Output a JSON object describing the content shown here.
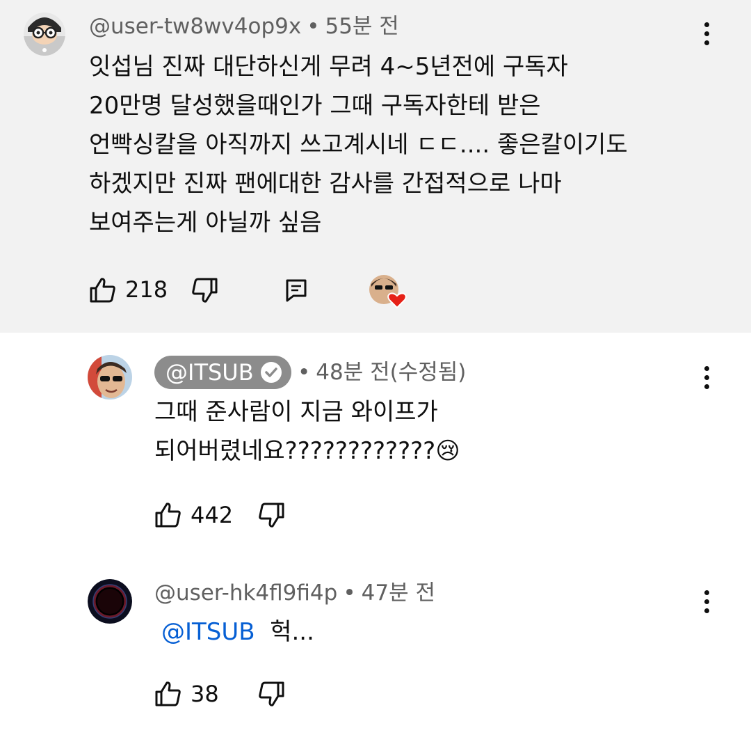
{
  "comments": [
    {
      "author": "@user-tw8wv4op9x",
      "time": "55분 전",
      "lines": [
        "잇섭님 진짜 대단하신게 무려 4~5년전에 구독자",
        "20만명 달성했을때인가 그때 구독자한테 받은",
        "언빡싱칼을 아직까지 쓰고계시네 ㄷㄷ.... 좋은칼이기도",
        "하겠지만 진짜 팬에대한 감사를 간접적으로 나마",
        "보여주는게 아닐까 싶음"
      ],
      "likes": "218"
    },
    {
      "author": "@ITSUB",
      "time": "48분 전(수정됨)",
      "lines": [
        "그때 준사람이 지금 와이프가",
        "되어버렸네요????????????"
      ],
      "emoji": "😢",
      "likes": "442"
    },
    {
      "author": "@user-hk4fl9fi4p",
      "time": "47분 전",
      "mention": "@ITSUB",
      "text": "헉...",
      "likes": "38"
    }
  ],
  "separator": "•",
  "colors": {
    "highlight_bg": "#f2f2f2",
    "meta_text": "#606060",
    "badge_bg": "#8c8c8c",
    "mention": "#065fd4",
    "heart": "#e62117"
  },
  "icons": {
    "like": "thumb-up-icon",
    "dislike": "thumb-down-icon",
    "reply": "reply-icon",
    "more": "more-vert-icon",
    "heart": "creator-heart-icon",
    "verified": "verified-check-icon"
  }
}
